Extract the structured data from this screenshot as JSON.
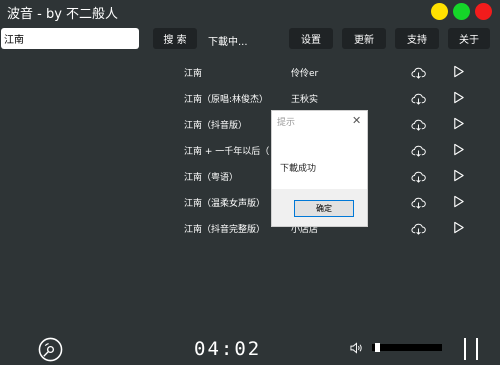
{
  "window": {
    "title": "波音 - by 不二般人"
  },
  "search": {
    "value": "江南",
    "button_label": "搜 索",
    "status": "下載中..."
  },
  "toolbar": {
    "settings": "设置",
    "update": "更新",
    "support": "支持",
    "about": "关于"
  },
  "songs": [
    {
      "name": "江南",
      "singer": "伶伶er"
    },
    {
      "name": "江南（原唱:林俊杰）",
      "singer": "王秋实"
    },
    {
      "name": "江南（抖音版）",
      "singer": ""
    },
    {
      "name": "江南 + 一千年以后（Li",
      "singer": ""
    },
    {
      "name": "江南（粤语）",
      "singer": ""
    },
    {
      "name": "江南（温柔女声版）",
      "singer": ""
    },
    {
      "name": "江南（抖音完整版）",
      "singer": "小店店"
    }
  ],
  "dialog": {
    "title": "提示",
    "message": "下載成功",
    "ok_label": "确定"
  },
  "player": {
    "time": "04:02",
    "volume_level": 0.05
  },
  "colors": {
    "background": "#2e3436",
    "button": "#1f2325",
    "close": "#f21c1c",
    "minimize": "#ffe100",
    "maximize": "#15d629"
  }
}
